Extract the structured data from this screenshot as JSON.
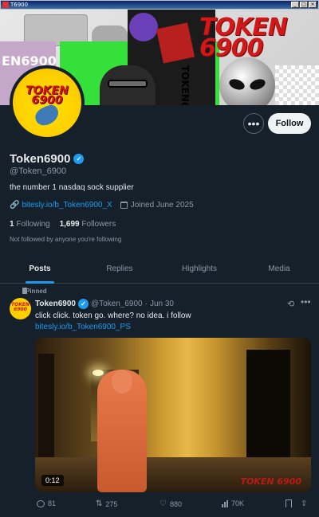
{
  "window": {
    "title": "T6900",
    "controls": [
      "_",
      "□",
      "×"
    ]
  },
  "banner": {
    "text_large": "TOKEN 6900",
    "text_left": "EN6900",
    "text_vertical": "TOKEN6"
  },
  "avatar": {
    "text": "TOKEN 6900"
  },
  "profile": {
    "more_icon": "•••",
    "follow_label": "Follow",
    "display_name": "Token6900",
    "verified_glyph": "✓",
    "handle": "@Token_6900",
    "bio": "the number 1 nasdaq sock supplier",
    "link": "bitesly.io/b_Token6900_X",
    "joined": "Joined June 2025",
    "following_count": "1",
    "following_label": "Following",
    "followers_count": "1,699",
    "followers_label": "Followers",
    "not_followed": "Not followed by anyone you're following"
  },
  "tabs": [
    {
      "label": "Posts",
      "active": true
    },
    {
      "label": "Replies",
      "active": false
    },
    {
      "label": "Highlights",
      "active": false
    },
    {
      "label": "Media",
      "active": false
    }
  ],
  "post": {
    "pinned_label": "Pinned",
    "author_name": "Token6900",
    "author_handle": "@Token_6900",
    "separator": "·",
    "date": "Jun 30",
    "avatar_text": "TOKEN 6900",
    "text": "click click. token go. where? no idea. i follow",
    "link": "bitesly.io/b_Token6900_PS",
    "video_duration": "0:12",
    "video_watermark": "TOKEN 6900",
    "more_icon": "•••",
    "grok_icon": "⟲",
    "replies": "81",
    "reposts": "275",
    "likes": "880",
    "views": "70K"
  },
  "icons": {
    "link": "🔗",
    "repost": "⇅",
    "like": "♡",
    "share": "⇪"
  }
}
